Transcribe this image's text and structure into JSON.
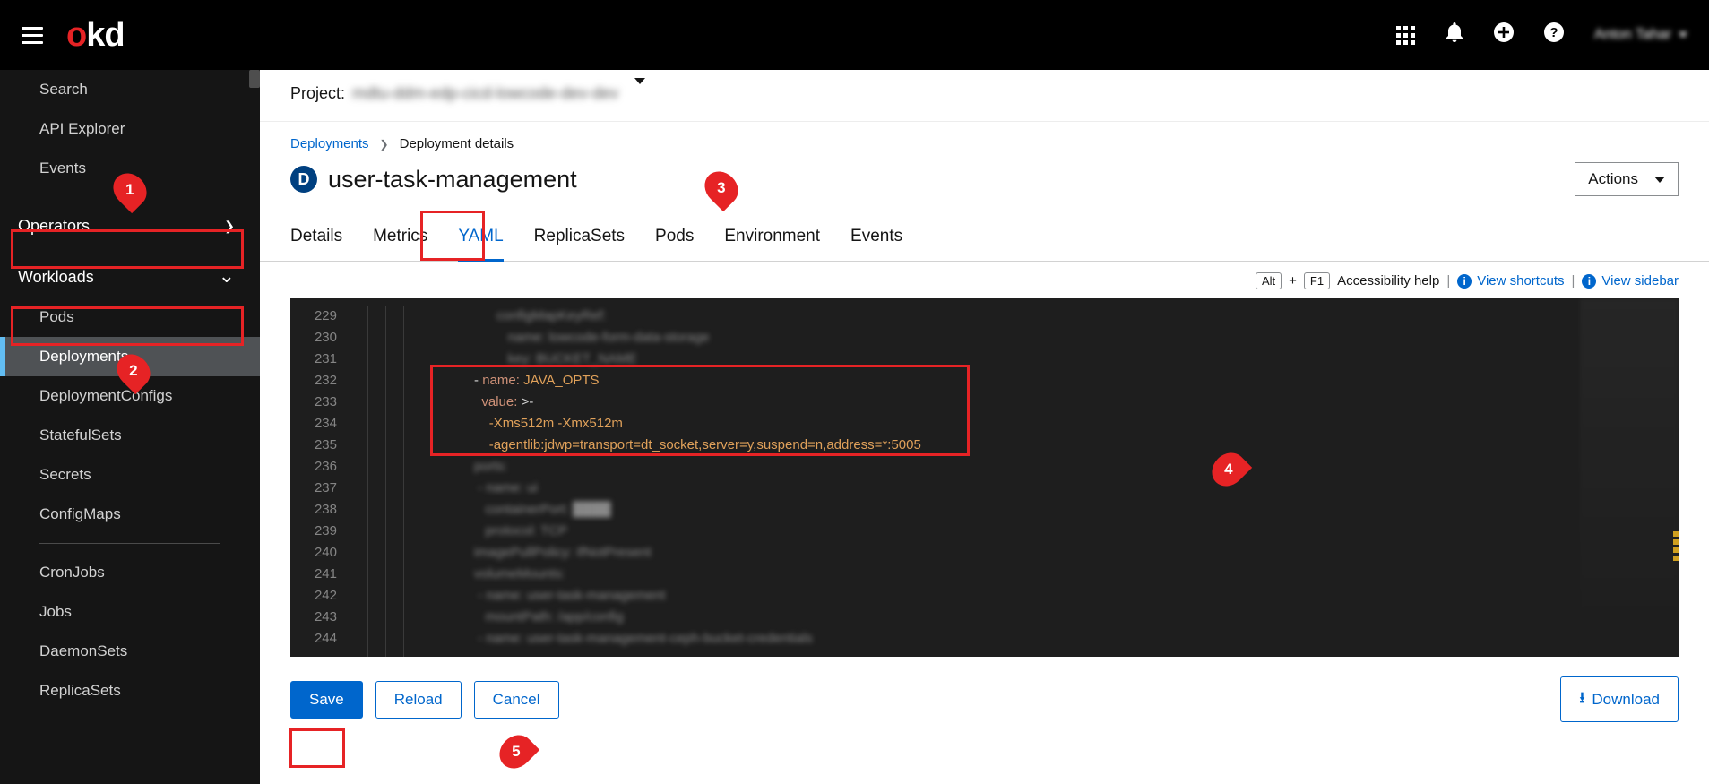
{
  "header": {
    "logo_o": "o",
    "logo_kd": "kd",
    "user_name": "Anton Tahar"
  },
  "sidebar": {
    "top_items": [
      "Search",
      "API Explorer",
      "Events"
    ],
    "sections": {
      "operators": "Operators",
      "workloads": "Workloads"
    },
    "workload_items_a": [
      "Pods",
      "Deployments",
      "DeploymentConfigs",
      "StatefulSets",
      "Secrets",
      "ConfigMaps"
    ],
    "workload_items_b": [
      "CronJobs",
      "Jobs",
      "DaemonSets",
      "ReplicaSets"
    ]
  },
  "project": {
    "label": "Project:",
    "name": "mdtu-ddm-edp-cicd-lowcode-dev-dev"
  },
  "breadcrumbs": {
    "parent": "Deployments",
    "current": "Deployment details"
  },
  "title": {
    "badge": "D",
    "text": "user-task-management",
    "actions": "Actions"
  },
  "tabs": [
    "Details",
    "Metrics",
    "YAML",
    "ReplicaSets",
    "Pods",
    "Environment",
    "Events"
  ],
  "active_tab": "YAML",
  "toolbar": {
    "alt": "Alt",
    "f1": "F1",
    "ahelp": "Accessibility help",
    "view_sc": "View shortcuts",
    "view_sb": "View sidebar"
  },
  "editor": {
    "line_start": 229,
    "line_end": 244,
    "visible": {
      "l232_dash": "-",
      "l232_key": "name:",
      "l232_val": "JAVA_OPTS",
      "l233_key": "value:",
      "l233_val": ">-",
      "l234": "-Xms512m -Xmx512m",
      "l235": "-agentlib:jdwp=transport=dt_socket,server=y,suspend=n,address=*:5005"
    },
    "blur": {
      "l229": "                                    configMapKeyRef:",
      "l230": "                                       name: lowcode-form-data-storage",
      "l231": "                                       key: BUCKET_NAME",
      "l236": "                              ports:",
      "l237": "                               - name: ui",
      "l238": "                                 containerPort: ████",
      "l239": "                                 protocol: TCP",
      "l240": "                              imagePullPolicy: IfNotPresent",
      "l241": "                              volumeMounts:",
      "l242": "                               - name: user-task-management",
      "l243": "                                 mountPath: /app/config",
      "l244": "                               - name: user-task-management-ceph-bucket-credentials"
    }
  },
  "buttons": {
    "save": "Save",
    "reload": "Reload",
    "cancel": "Cancel",
    "download": "Download"
  },
  "annotations": {
    "m1": "1",
    "m2": "2",
    "m3": "3",
    "m4": "4",
    "m5": "5"
  }
}
